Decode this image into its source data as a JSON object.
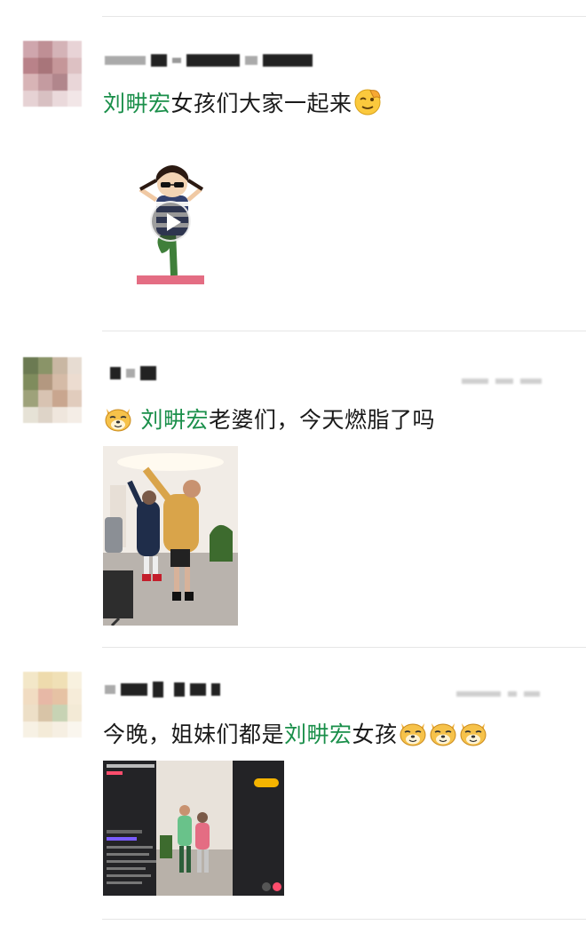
{
  "feed": {
    "posts": [
      {
        "text_parts": [
          {
            "text": "刘畊宏",
            "highlight": true
          },
          {
            "text": "女孩们大家一起来",
            "highlight": false
          }
        ],
        "trailing_emoji": "salute-face-emoji",
        "media": {
          "type": "video",
          "icon": "play-icon",
          "subject": "cartoon-girl-yoga-pose"
        }
      },
      {
        "leading_emoji": "doge-emoji",
        "text_parts": [
          {
            "text": "刘畊宏",
            "highlight": true
          },
          {
            "text": "老婆们，今天燃脂了吗",
            "highlight": false
          }
        ],
        "media": {
          "type": "photo",
          "subject": "two-people-dancing-in-living-room"
        }
      },
      {
        "text_parts": [
          {
            "text": "今晚，姐妹们都是",
            "highlight": false
          },
          {
            "text": "刘畊宏",
            "highlight": true
          },
          {
            "text": "女孩",
            "highlight": false
          }
        ],
        "trailing_emoji": [
          "doge-emoji",
          "doge-emoji",
          "doge-emoji"
        ],
        "media": {
          "type": "livestream-screenshot",
          "subject": "livestream-workout-screen"
        }
      }
    ]
  },
  "colors": {
    "highlight_name": "#1a8f4a",
    "text": "#1a1a1a",
    "divider": "#e6e6e6"
  }
}
